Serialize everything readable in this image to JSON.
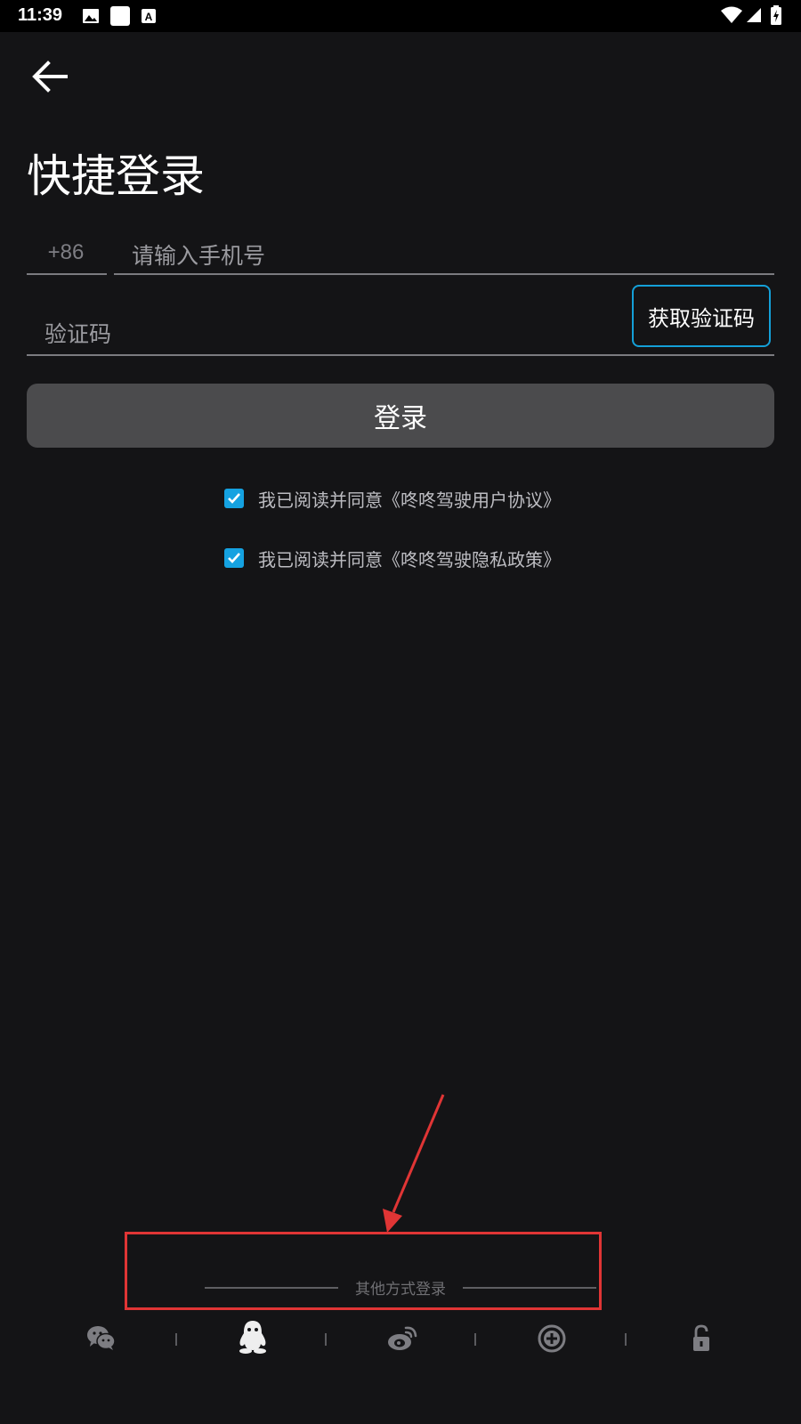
{
  "status_bar": {
    "time": "11:39"
  },
  "page": {
    "title": "快捷登录"
  },
  "form": {
    "country_code": "+86",
    "phone_placeholder": "请输入手机号",
    "phone_value": "",
    "code_placeholder": "验证码",
    "code_value": "",
    "get_code_label": "获取验证码",
    "login_label": "登录"
  },
  "agreements": [
    {
      "text": "我已阅读并同意《咚咚驾驶用户协议》",
      "checked": true
    },
    {
      "text": "我已阅读并同意《咚咚驾驶隐私政策》",
      "checked": true
    }
  ],
  "other_login": {
    "label": "其他方式登录",
    "options": [
      "wechat-icon",
      "qq-icon",
      "weibo-icon",
      "plus-circle-icon",
      "unlock-icon"
    ]
  },
  "colors": {
    "background": "#141416",
    "accent": "#15a2e1",
    "login_button": "#4b4b4d",
    "annotation": "#e03535"
  }
}
